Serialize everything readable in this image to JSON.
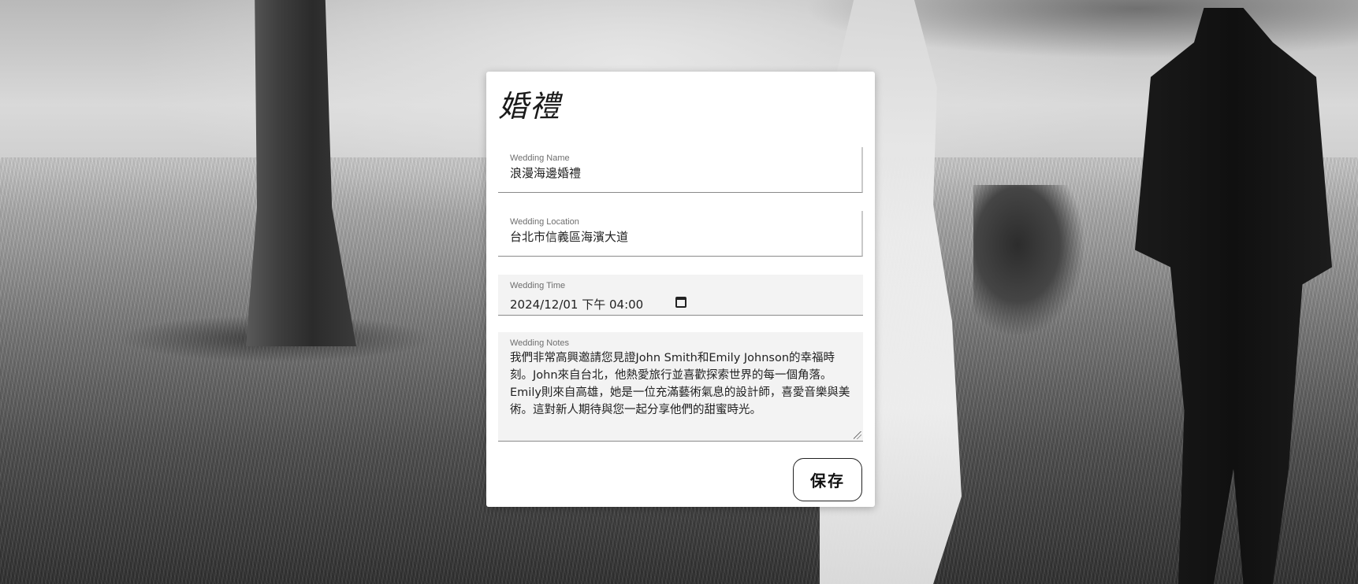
{
  "card": {
    "title": "婚禮"
  },
  "form": {
    "name": {
      "label": "Wedding Name",
      "value": "浪漫海邊婚禮"
    },
    "location": {
      "label": "Wedding Location",
      "value": "台北市信義區海濱大道"
    },
    "time": {
      "label": "Wedding Time",
      "value": "2024/12/01 下午 04:00"
    },
    "notes": {
      "label": "Wedding Notes",
      "value": "我們非常高興邀請您見證John Smith和Emily Johnson的幸福時刻。John來自台北，他熱愛旅行並喜歡探索世界的每一個角落。Emily則來自高雄，她是一位充滿藝術氣息的設計師，喜愛音樂與美術。這對新人期待與您一起分享他們的甜蜜時光。"
    },
    "save_label": "保存"
  },
  "icons": {
    "time": "calendar-icon",
    "notes": "resize-handle-icon"
  },
  "background": {
    "description_colors": {
      "card": "#ffffff",
      "text": "#222222"
    }
  }
}
